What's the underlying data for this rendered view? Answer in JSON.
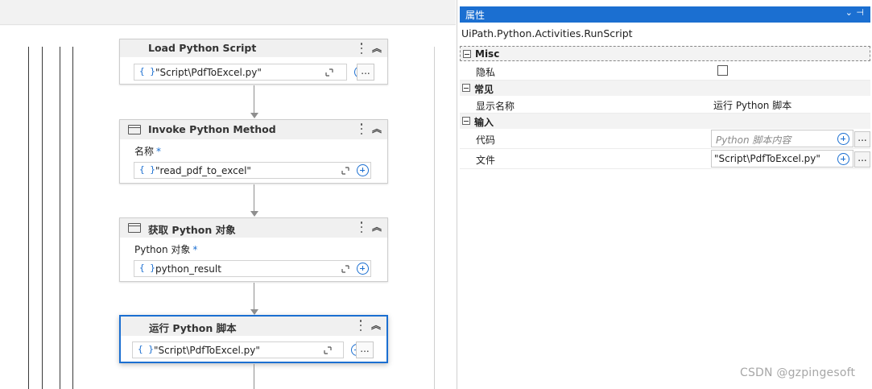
{
  "designer": {
    "activities": [
      {
        "title": "Load Python Script",
        "field_value": "\"Script\\PdfToExcel.py\"",
        "field_brace": "{ }",
        "dots": "..."
      },
      {
        "title": "Invoke Python Method",
        "label": "名称",
        "required": "*",
        "field_value": "\"read_pdf_to_excel\"",
        "field_brace": "{ }"
      },
      {
        "title": "获取 Python 对象",
        "label": "Python 对象",
        "required": "*",
        "field_value": "python_result",
        "field_brace": "{ }"
      },
      {
        "title": "运行 Python 脚本",
        "field_value": "\"Script\\PdfToExcel.py\"",
        "field_brace": "{ }",
        "dots": "...",
        "selected": true
      }
    ]
  },
  "properties": {
    "title": "属性",
    "type_name": "UiPath.Python.Activities.RunScript",
    "categories": [
      {
        "name": "Misc",
        "rows": [
          {
            "name": "隐私",
            "type": "checkbox",
            "checked": false
          }
        ]
      },
      {
        "name": "常见",
        "rows": [
          {
            "name": "显示名称",
            "value": "运行 Python 脚本"
          }
        ]
      },
      {
        "name": "输入",
        "rows": [
          {
            "name": "代码",
            "placeholder": "Python 脚本内容",
            "dots": "..."
          },
          {
            "name": "文件",
            "value": "\"Script\\PdfToExcel.py\"",
            "dots": "..."
          }
        ]
      }
    ]
  },
  "watermark": "CSDN @gzpingesoft",
  "colors": {
    "accent": "#1b6fd1",
    "header_bg": "#f0f0f0",
    "selected_border": "#1b6fd1"
  }
}
